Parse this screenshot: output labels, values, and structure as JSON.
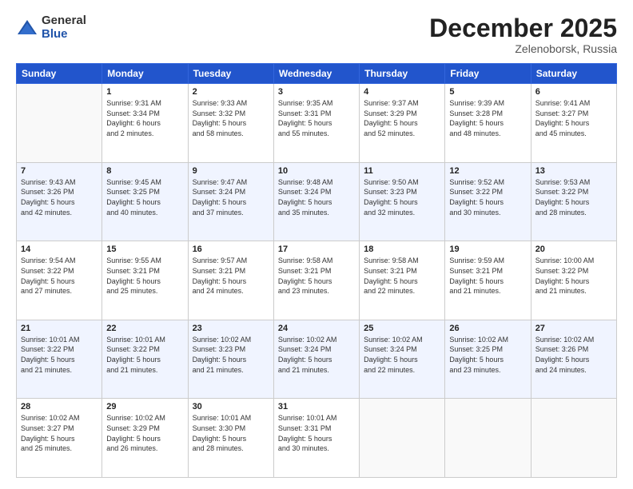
{
  "logo": {
    "general": "General",
    "blue": "Blue"
  },
  "header": {
    "month": "December 2025",
    "location": "Zelenoborsk, Russia"
  },
  "weekdays": [
    "Sunday",
    "Monday",
    "Tuesday",
    "Wednesday",
    "Thursday",
    "Friday",
    "Saturday"
  ],
  "weeks": [
    [
      {
        "day": "",
        "info": ""
      },
      {
        "day": "1",
        "info": "Sunrise: 9:31 AM\nSunset: 3:34 PM\nDaylight: 6 hours\nand 2 minutes."
      },
      {
        "day": "2",
        "info": "Sunrise: 9:33 AM\nSunset: 3:32 PM\nDaylight: 5 hours\nand 58 minutes."
      },
      {
        "day": "3",
        "info": "Sunrise: 9:35 AM\nSunset: 3:31 PM\nDaylight: 5 hours\nand 55 minutes."
      },
      {
        "day": "4",
        "info": "Sunrise: 9:37 AM\nSunset: 3:29 PM\nDaylight: 5 hours\nand 52 minutes."
      },
      {
        "day": "5",
        "info": "Sunrise: 9:39 AM\nSunset: 3:28 PM\nDaylight: 5 hours\nand 48 minutes."
      },
      {
        "day": "6",
        "info": "Sunrise: 9:41 AM\nSunset: 3:27 PM\nDaylight: 5 hours\nand 45 minutes."
      }
    ],
    [
      {
        "day": "7",
        "info": "Sunrise: 9:43 AM\nSunset: 3:26 PM\nDaylight: 5 hours\nand 42 minutes."
      },
      {
        "day": "8",
        "info": "Sunrise: 9:45 AM\nSunset: 3:25 PM\nDaylight: 5 hours\nand 40 minutes."
      },
      {
        "day": "9",
        "info": "Sunrise: 9:47 AM\nSunset: 3:24 PM\nDaylight: 5 hours\nand 37 minutes."
      },
      {
        "day": "10",
        "info": "Sunrise: 9:48 AM\nSunset: 3:24 PM\nDaylight: 5 hours\nand 35 minutes."
      },
      {
        "day": "11",
        "info": "Sunrise: 9:50 AM\nSunset: 3:23 PM\nDaylight: 5 hours\nand 32 minutes."
      },
      {
        "day": "12",
        "info": "Sunrise: 9:52 AM\nSunset: 3:22 PM\nDaylight: 5 hours\nand 30 minutes."
      },
      {
        "day": "13",
        "info": "Sunrise: 9:53 AM\nSunset: 3:22 PM\nDaylight: 5 hours\nand 28 minutes."
      }
    ],
    [
      {
        "day": "14",
        "info": "Sunrise: 9:54 AM\nSunset: 3:22 PM\nDaylight: 5 hours\nand 27 minutes."
      },
      {
        "day": "15",
        "info": "Sunrise: 9:55 AM\nSunset: 3:21 PM\nDaylight: 5 hours\nand 25 minutes."
      },
      {
        "day": "16",
        "info": "Sunrise: 9:57 AM\nSunset: 3:21 PM\nDaylight: 5 hours\nand 24 minutes."
      },
      {
        "day": "17",
        "info": "Sunrise: 9:58 AM\nSunset: 3:21 PM\nDaylight: 5 hours\nand 23 minutes."
      },
      {
        "day": "18",
        "info": "Sunrise: 9:58 AM\nSunset: 3:21 PM\nDaylight: 5 hours\nand 22 minutes."
      },
      {
        "day": "19",
        "info": "Sunrise: 9:59 AM\nSunset: 3:21 PM\nDaylight: 5 hours\nand 21 minutes."
      },
      {
        "day": "20",
        "info": "Sunrise: 10:00 AM\nSunset: 3:22 PM\nDaylight: 5 hours\nand 21 minutes."
      }
    ],
    [
      {
        "day": "21",
        "info": "Sunrise: 10:01 AM\nSunset: 3:22 PM\nDaylight: 5 hours\nand 21 minutes."
      },
      {
        "day": "22",
        "info": "Sunrise: 10:01 AM\nSunset: 3:22 PM\nDaylight: 5 hours\nand 21 minutes."
      },
      {
        "day": "23",
        "info": "Sunrise: 10:02 AM\nSunset: 3:23 PM\nDaylight: 5 hours\nand 21 minutes."
      },
      {
        "day": "24",
        "info": "Sunrise: 10:02 AM\nSunset: 3:24 PM\nDaylight: 5 hours\nand 21 minutes."
      },
      {
        "day": "25",
        "info": "Sunrise: 10:02 AM\nSunset: 3:24 PM\nDaylight: 5 hours\nand 22 minutes."
      },
      {
        "day": "26",
        "info": "Sunrise: 10:02 AM\nSunset: 3:25 PM\nDaylight: 5 hours\nand 23 minutes."
      },
      {
        "day": "27",
        "info": "Sunrise: 10:02 AM\nSunset: 3:26 PM\nDaylight: 5 hours\nand 24 minutes."
      }
    ],
    [
      {
        "day": "28",
        "info": "Sunrise: 10:02 AM\nSunset: 3:27 PM\nDaylight: 5 hours\nand 25 minutes."
      },
      {
        "day": "29",
        "info": "Sunrise: 10:02 AM\nSunset: 3:29 PM\nDaylight: 5 hours\nand 26 minutes."
      },
      {
        "day": "30",
        "info": "Sunrise: 10:01 AM\nSunset: 3:30 PM\nDaylight: 5 hours\nand 28 minutes."
      },
      {
        "day": "31",
        "info": "Sunrise: 10:01 AM\nSunset: 3:31 PM\nDaylight: 5 hours\nand 30 minutes."
      },
      {
        "day": "",
        "info": ""
      },
      {
        "day": "",
        "info": ""
      },
      {
        "day": "",
        "info": ""
      }
    ]
  ]
}
